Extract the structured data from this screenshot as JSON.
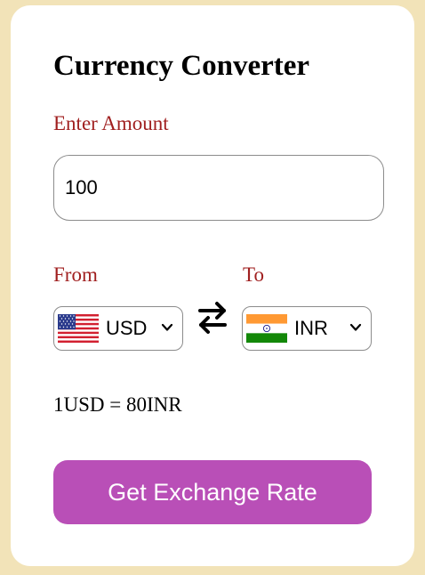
{
  "title": "Currency Converter",
  "amount": {
    "label": "Enter Amount",
    "value": "100"
  },
  "from": {
    "label": "From",
    "selected": "USD",
    "flag_icon": "us-flag-icon"
  },
  "to": {
    "label": "To",
    "selected": "INR",
    "flag_icon": "india-flag-icon"
  },
  "swap_icon": "swap-arrows-icon",
  "exchange_rate_text": "1USD = 80INR",
  "button": {
    "label": "Get Exchange Rate"
  },
  "colors": {
    "page_background": "#f2e3b8",
    "label_color": "#a01f1f",
    "button_color": "#b94fb7"
  }
}
